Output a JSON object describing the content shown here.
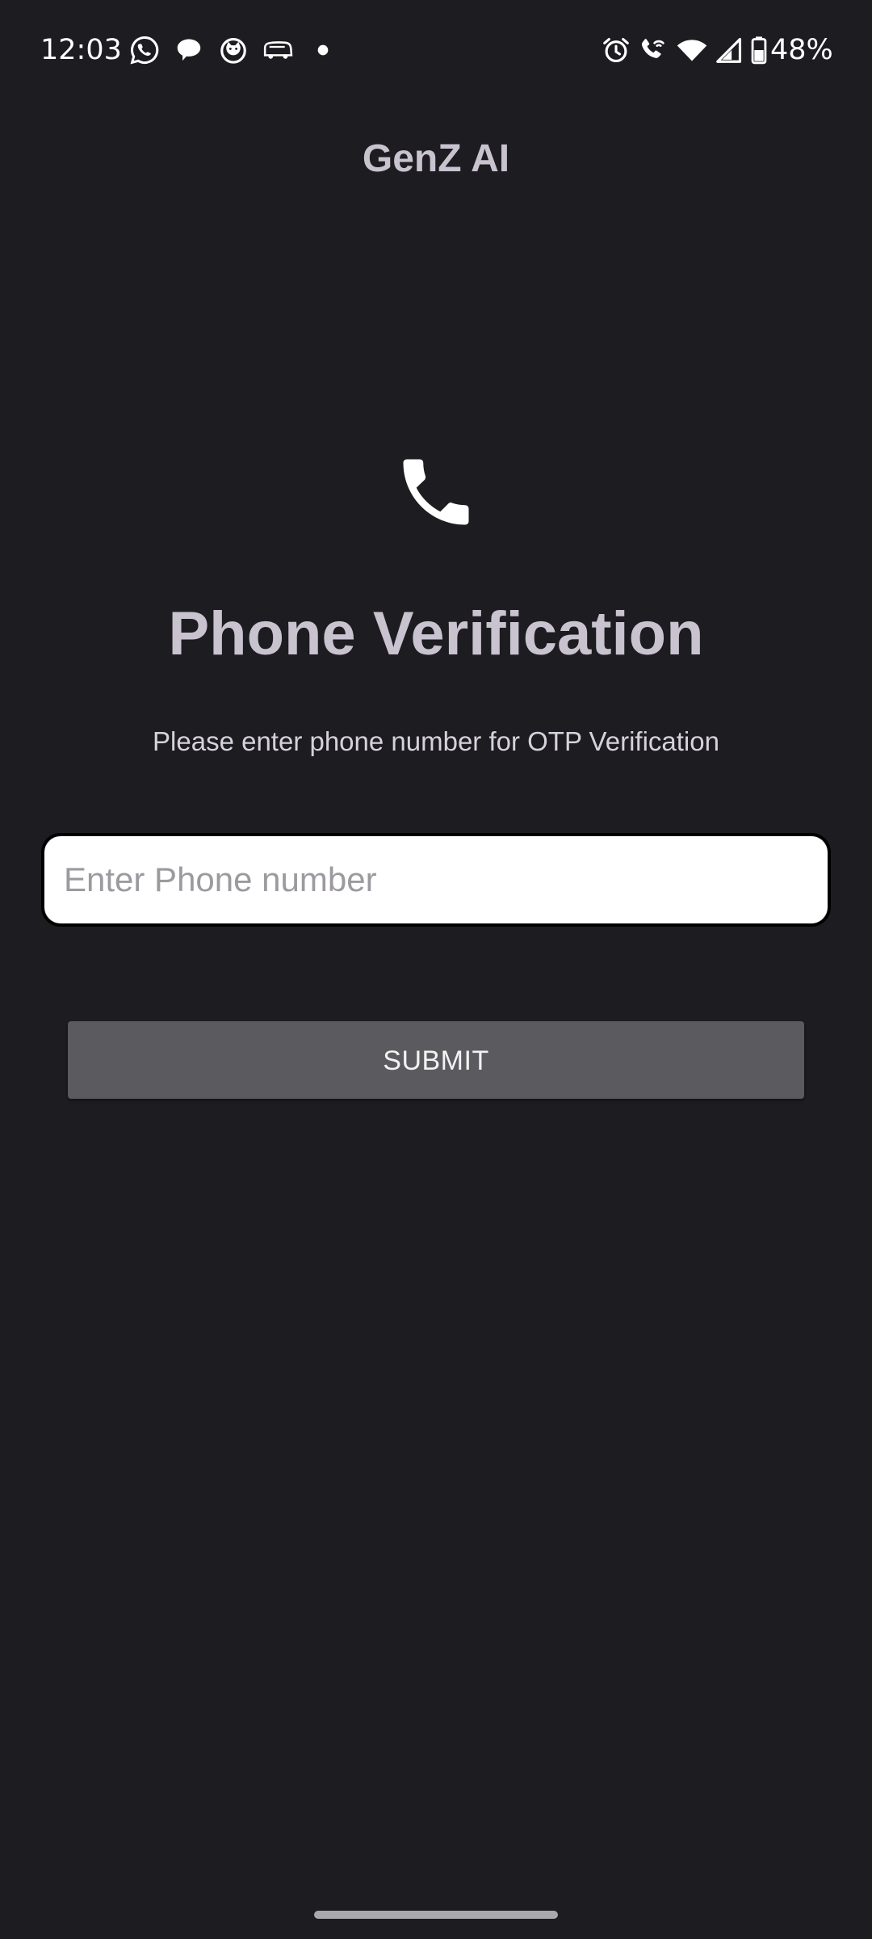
{
  "status_bar": {
    "time": "12:03",
    "battery_percent": "48%",
    "left_icons": [
      "whatsapp-icon",
      "chat-bubble-icon",
      "cat-face-icon",
      "bus-icon",
      "dot-icon"
    ],
    "right_icons": [
      "alarm-icon",
      "wifi-call-icon",
      "wifi-icon",
      "signal-icon",
      "battery-icon"
    ]
  },
  "header": {
    "title": "GenZ AI"
  },
  "main": {
    "icon": "phone-icon",
    "title": "Phone Verification",
    "subtitle": "Please enter phone number for OTP Verification",
    "phone_input": {
      "value": "",
      "placeholder": "Enter Phone number"
    },
    "submit_label": "SUBMIT"
  },
  "colors": {
    "background": "#1d1c21",
    "title_text": "#c8c3cf",
    "button_bg": "#5b5b5f",
    "input_bg": "#ffffff"
  }
}
